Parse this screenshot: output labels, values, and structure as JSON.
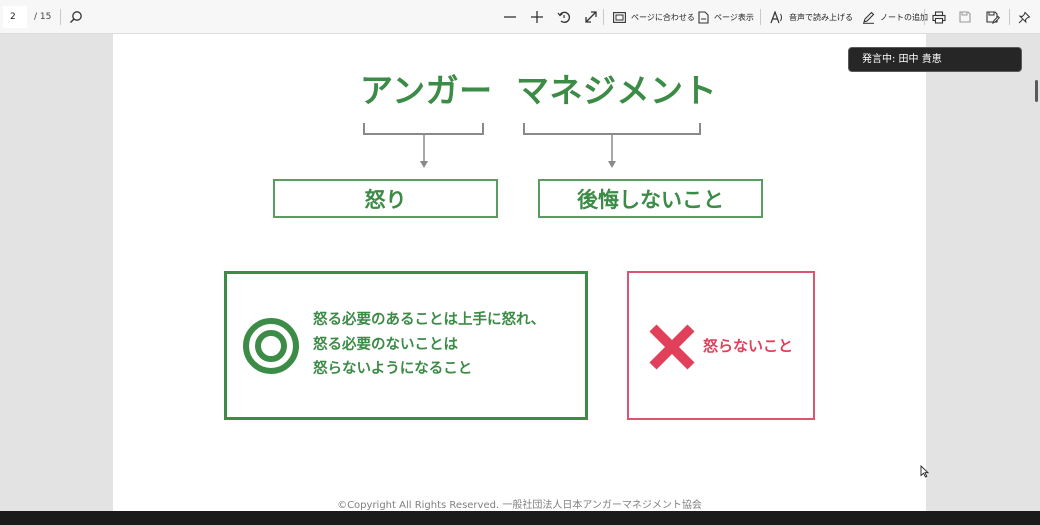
{
  "toolbar": {
    "page_current": "2",
    "page_total": "/ 15",
    "fit_page_label": "ページに合わせる",
    "page_view_label": "ページ表示",
    "read_aloud_label": "音声で読み上げる",
    "add_note_label": "ノートの追加"
  },
  "toast": {
    "speaking": "発言中: 田中 貴恵"
  },
  "slide": {
    "title_left": "アンガー",
    "title_right": "マネジメント",
    "box_anger": "怒り",
    "box_no_regret": "後悔しないこと",
    "good_lines": [
      "怒る必要のあることは上手に怒れ、",
      "怒る必要のないことは",
      "怒らないようになること"
    ],
    "bad_label": "怒らないこと",
    "footer": "©Copyright All Rights Reserved. 一般社団法人日本アンガーマネジメント協会"
  },
  "colors": {
    "green": "#3c8b47",
    "green_light": "#5b9d60",
    "red": "#e0405a",
    "red_border": "#d9566e",
    "toast_bg": "#262626",
    "taskbar": "#1b1b1b"
  },
  "icons": [
    "search-icon",
    "minus-icon",
    "plus-icon",
    "rotate-icon",
    "fullscreen-icon",
    "fit-page-icon",
    "page-view-icon",
    "read-aloud-icon",
    "pen-icon",
    "print-icon",
    "save-icon",
    "save-as-icon",
    "pin-icon",
    "double-circle-icon",
    "cross-icon",
    "cursor-icon"
  ]
}
